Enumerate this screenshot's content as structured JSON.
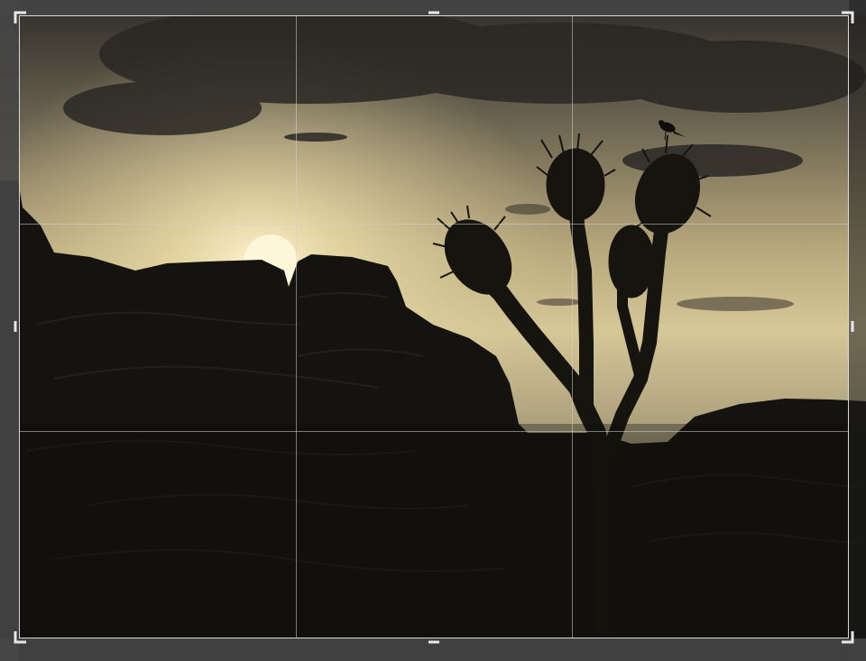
{
  "app": {
    "view": "crop-tool",
    "overlay": "rule-of-thirds"
  },
  "image": {
    "subject": "joshua-tree-silhouette-at-sunset",
    "colors": {
      "sky_top": "#3a3630",
      "sky_glow": "#e9dca8",
      "sun": "#fff6d8",
      "cloud": "#2b2826",
      "silhouette": "#141210"
    }
  },
  "crop": {
    "grid": "3x3",
    "handles": [
      "top-left",
      "top",
      "top-right",
      "left",
      "right",
      "bottom-left",
      "bottom",
      "bottom-right"
    ]
  }
}
